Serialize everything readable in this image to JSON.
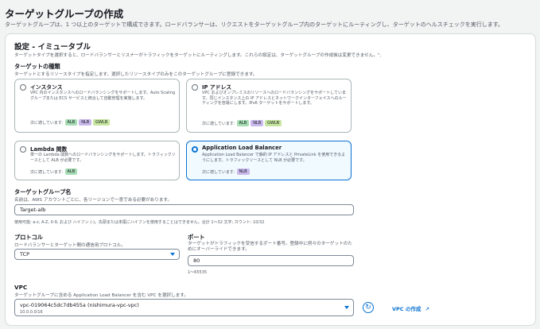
{
  "page": {
    "title": "ターゲットグループの作成",
    "description": "ターゲットグループは、1 つ以上のターゲットで構成できます。ロードバランサーは、リクエストをターゲットグループ内のターゲットにルーティングし、ターゲットのヘルスチェックを実行します。"
  },
  "settings": {
    "title": "設定 - イミュータブル",
    "description": "ターゲットタイプを選択すると、ロードバランサーとリスナーがトラフィックをターゲットにルーティングします。これらの設定は、ターゲットグループの作成後は変更できません。\","
  },
  "target_type": {
    "label": "ターゲットの種類",
    "description": "ターゲットとするリソースタイプを指定します。選択したリソースタイプのみをこのターゲットグループに登録できます。",
    "compat_label": "次に適しています:",
    "options": [
      {
        "title": "インスタンス",
        "desc": "VPC 内のインスタンスへのロードバランシングをサポートします。Auto Scaling グループまたは ECS サービスと統合して自動管理を実施します。",
        "tags": [
          "ALB",
          "NLB",
          "GWLB"
        ],
        "selected": false
      },
      {
        "title": "IP アドレス",
        "desc": "VPC およびオンプレミスのリソースへのロードバランシングをサポートしています。同じインスタンス上の IP アドレスとネットワークインターフェイスへのルーティングを容易にします。IPv6 ターゲットをサポートします。",
        "tags": [
          "ALB",
          "NLB",
          "GWLB"
        ],
        "selected": false
      },
      {
        "title": "Lambda 関数",
        "desc": "単一の Lambda 関数へのロードバランシングをサポートします。トラフィックソースとして ALB が必要です。",
        "tags": [
          "ALB"
        ],
        "selected": false
      },
      {
        "title": "Application Load Balancer",
        "desc": "Application Load Balancer で静的 IP アドレスと PrivateLink を使用できるようにします。トラフィックソースとして NLB が必要です。",
        "tags": [
          "NLB"
        ],
        "selected": true
      }
    ]
  },
  "group_name": {
    "label": "ターゲットグループ名",
    "description": "名前は、AWS アカウントごとに、各リージョンで一意である必要があります。",
    "value": "Target-alb",
    "hint": "使用可能: a-z, A-Z, 0-9, および ハイフン (-)。先頭または末尾にハイフンを使用することはできません。合計 1〜32 文字; カウント: 10/32"
  },
  "protocol": {
    "label": "プロトコル",
    "description": "ロードバランサーとターゲット間の通信用プロトコル。",
    "value": "TCP"
  },
  "port": {
    "label": "ポート",
    "description": "ターゲットがトラフィックを受信するポート番号。登録中に例々のターゲットのためにオーバーライドできます。",
    "value": "80",
    "hint": "1〜65535"
  },
  "vpc": {
    "label": "VPC",
    "description": "ターゲットグループに含める Application Load Balancer を含む VPC を選択します。",
    "value": "vpc-019064c5dc7db455a (nishimura-vpc-vpc)",
    "cidr": "10.0.0.0/16",
    "create_link": "VPC の作成"
  },
  "colors": {
    "accent": "#0972d3",
    "alb": "#a7ddb4",
    "nlb": "#c9b8ec",
    "gwlb": "#c6e6a0"
  },
  "icons": {
    "refresh": "refresh-icon",
    "external": "external-link-icon",
    "caret": "caret-down-icon"
  }
}
